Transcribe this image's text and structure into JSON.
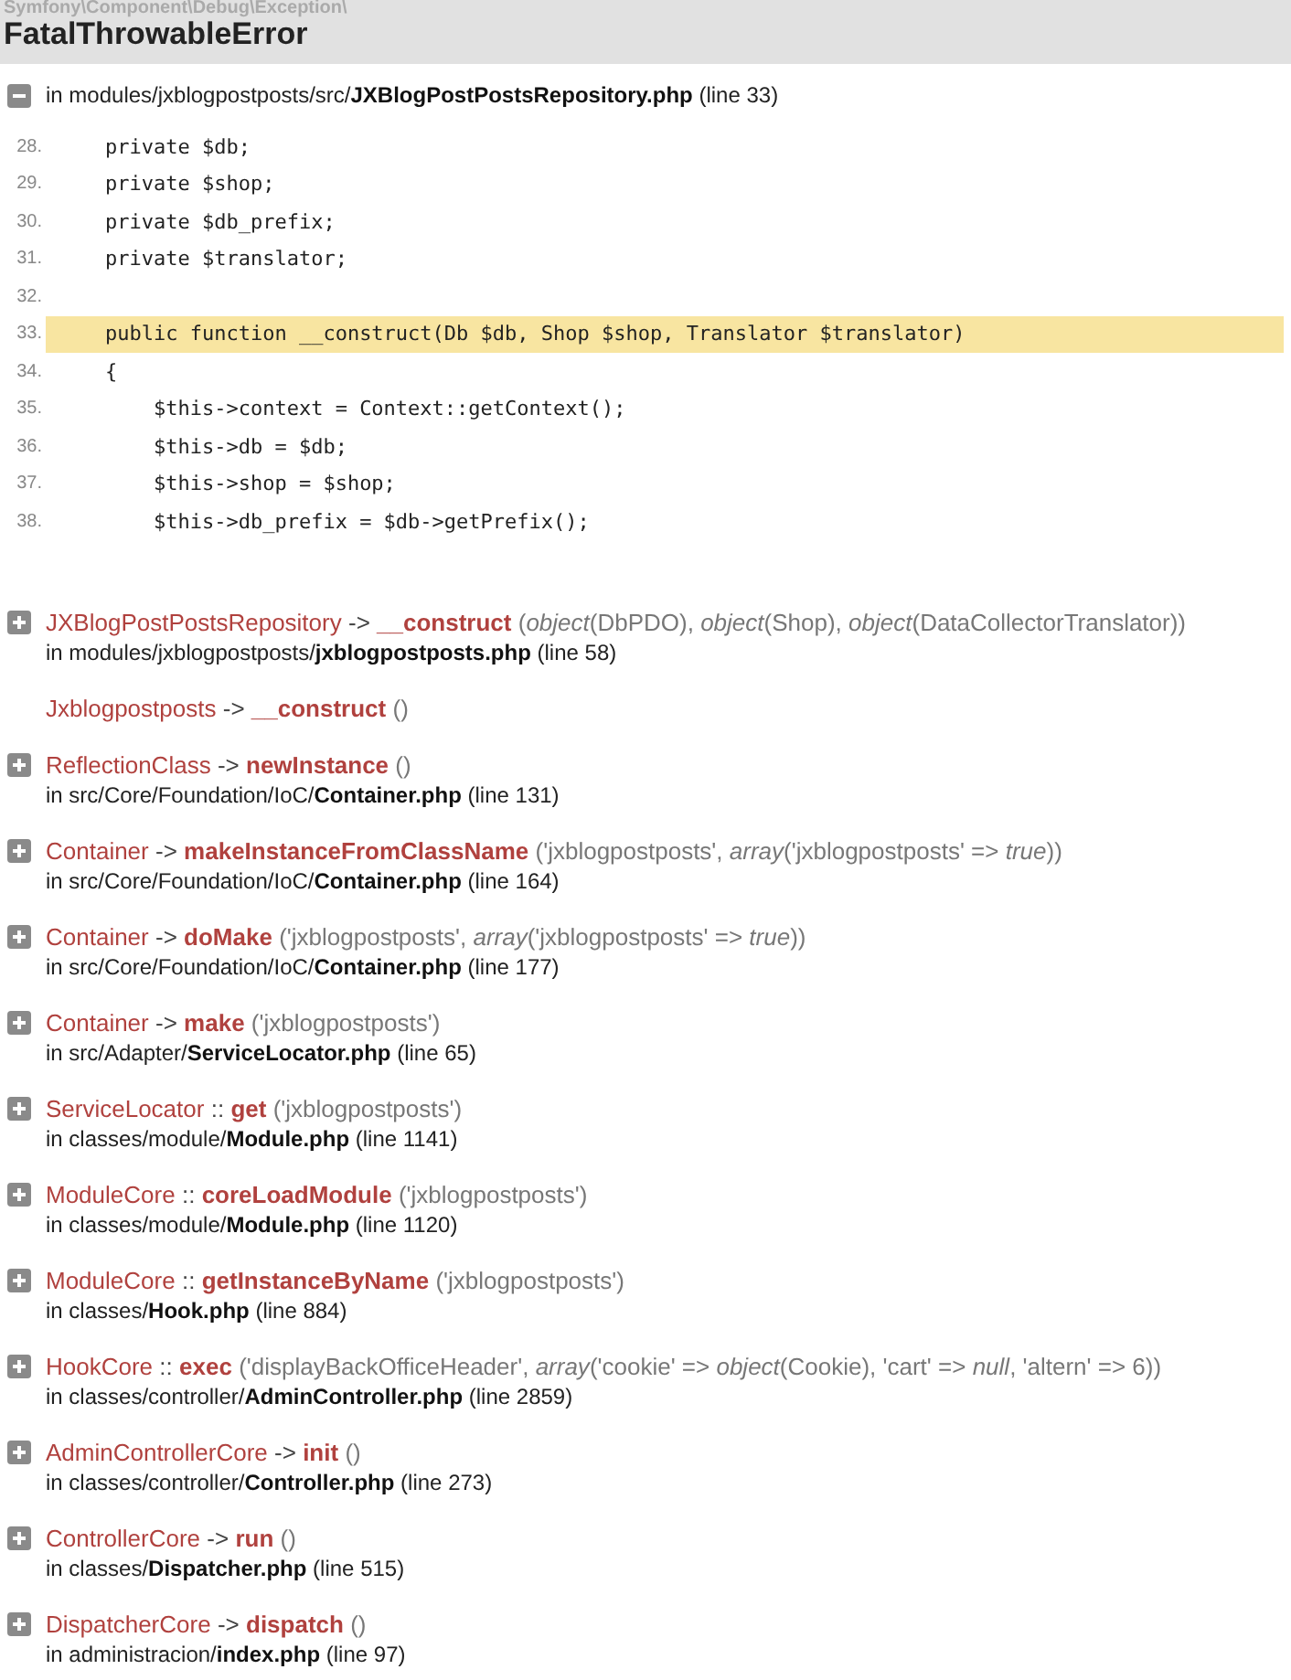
{
  "header": {
    "namespace": "Symfony\\Component\\Debug\\Exception\\",
    "title": "FatalThrowableError"
  },
  "trace": [
    {
      "expanded": true,
      "file": "in modules/jxblogpostposts/src/**JXBlogPostPostsRepository.php** (line 33)",
      "code": [
        {
          "number": "28.",
          "text": "    private $db;",
          "highlighted": false
        },
        {
          "number": "29.",
          "text": "    private $shop;",
          "highlighted": false
        },
        {
          "number": "30.",
          "text": "    private $db_prefix;",
          "highlighted": false
        },
        {
          "number": "31.",
          "text": "    private $translator;",
          "highlighted": false
        },
        {
          "number": "32.",
          "highlighted": false
        },
        {
          "number": "33.",
          "text": "    public function __construct(Db $db, Shop $shop, Translator $translator)",
          "highlighted": true
        },
        {
          "number": "34.",
          "text": "    {",
          "highlighted": false
        },
        {
          "number": "35.",
          "text": "        $this->context = Context::getContext();",
          "highlighted": false
        },
        {
          "number": "36.",
          "text": "        $this->db = $db;",
          "highlighted": false
        },
        {
          "number": "37.",
          "text": "        $this->shop = $shop;",
          "highlighted": false
        },
        {
          "number": "38.",
          "text": "        $this->db_prefix = $db->getPrefix();",
          "highlighted": false
        }
      ]
    },
    {
      "expanded": false,
      "class": "JXBlogPostPostsRepository",
      "operator": "->",
      "method": "__construct",
      "args": "(*object*(DbPDO), *object*(Shop), *object*(DataCollectorTranslator))",
      "file": "in modules/jxblogpostposts/**jxblogpostposts.php** (line 58)"
    },
    {
      "class": "Jxblogpostposts",
      "operator": "->",
      "method": "__construct",
      "args": "()"
    },
    {
      "expanded": false,
      "class": "ReflectionClass",
      "operator": "->",
      "method": "newInstance",
      "args": "()",
      "file": "in src/Core/Foundation/IoC/**Container.php** (line 131)"
    },
    {
      "expanded": false,
      "class": "Container",
      "operator": "->",
      "method": "makeInstanceFromClassName",
      "args": "('jxblogpostposts', *array*('jxblogpostposts' => *true*))",
      "file": "in src/Core/Foundation/IoC/**Container.php** (line 164)"
    },
    {
      "expanded": false,
      "class": "Container",
      "operator": "->",
      "method": "doMake",
      "args": "('jxblogpostposts', *array*('jxblogpostposts' => *true*))",
      "file": "in src/Core/Foundation/IoC/**Container.php** (line 177)"
    },
    {
      "expanded": false,
      "class": "Container",
      "operator": "->",
      "method": "make",
      "args": "('jxblogpostposts')",
      "file": "in src/Adapter/**ServiceLocator.php** (line 65)"
    },
    {
      "expanded": false,
      "class": "ServiceLocator",
      "operator": "::",
      "method": "get",
      "args": "('jxblogpostposts')",
      "file": "in classes/module/**Module.php** (line 1141)"
    },
    {
      "expanded": false,
      "class": "ModuleCore",
      "operator": "::",
      "method": "coreLoadModule",
      "args": "('jxblogpostposts')",
      "file": "in classes/module/**Module.php** (line 1120)"
    },
    {
      "expanded": false,
      "class": "ModuleCore",
      "operator": "::",
      "method": "getInstanceByName",
      "args": "('jxblogpostposts')",
      "file": "in classes/**Hook.php** (line 884)"
    },
    {
      "expanded": false,
      "class": "HookCore",
      "operator": "::",
      "method": "exec",
      "args": "('displayBackOfficeHeader', *array*('cookie' => *object*(Cookie), 'cart' => *null*, 'altern' => 6))",
      "file": "in classes/controller/**AdminController.php** (line 2859)"
    },
    {
      "expanded": false,
      "class": "AdminControllerCore",
      "operator": "->",
      "method": "init",
      "args": "()",
      "file": "in classes/controller/**Controller.php** (line 273)"
    },
    {
      "expanded": false,
      "class": "ControllerCore",
      "operator": "->",
      "method": "run",
      "args": "()",
      "file": "in classes/**Dispatcher.php** (line 515)"
    },
    {
      "expanded": false,
      "class": "DispatcherCore",
      "operator": "->",
      "method": "dispatch",
      "args": "()",
      "file": "in administracion/**index.php** (line 97)"
    }
  ]
}
